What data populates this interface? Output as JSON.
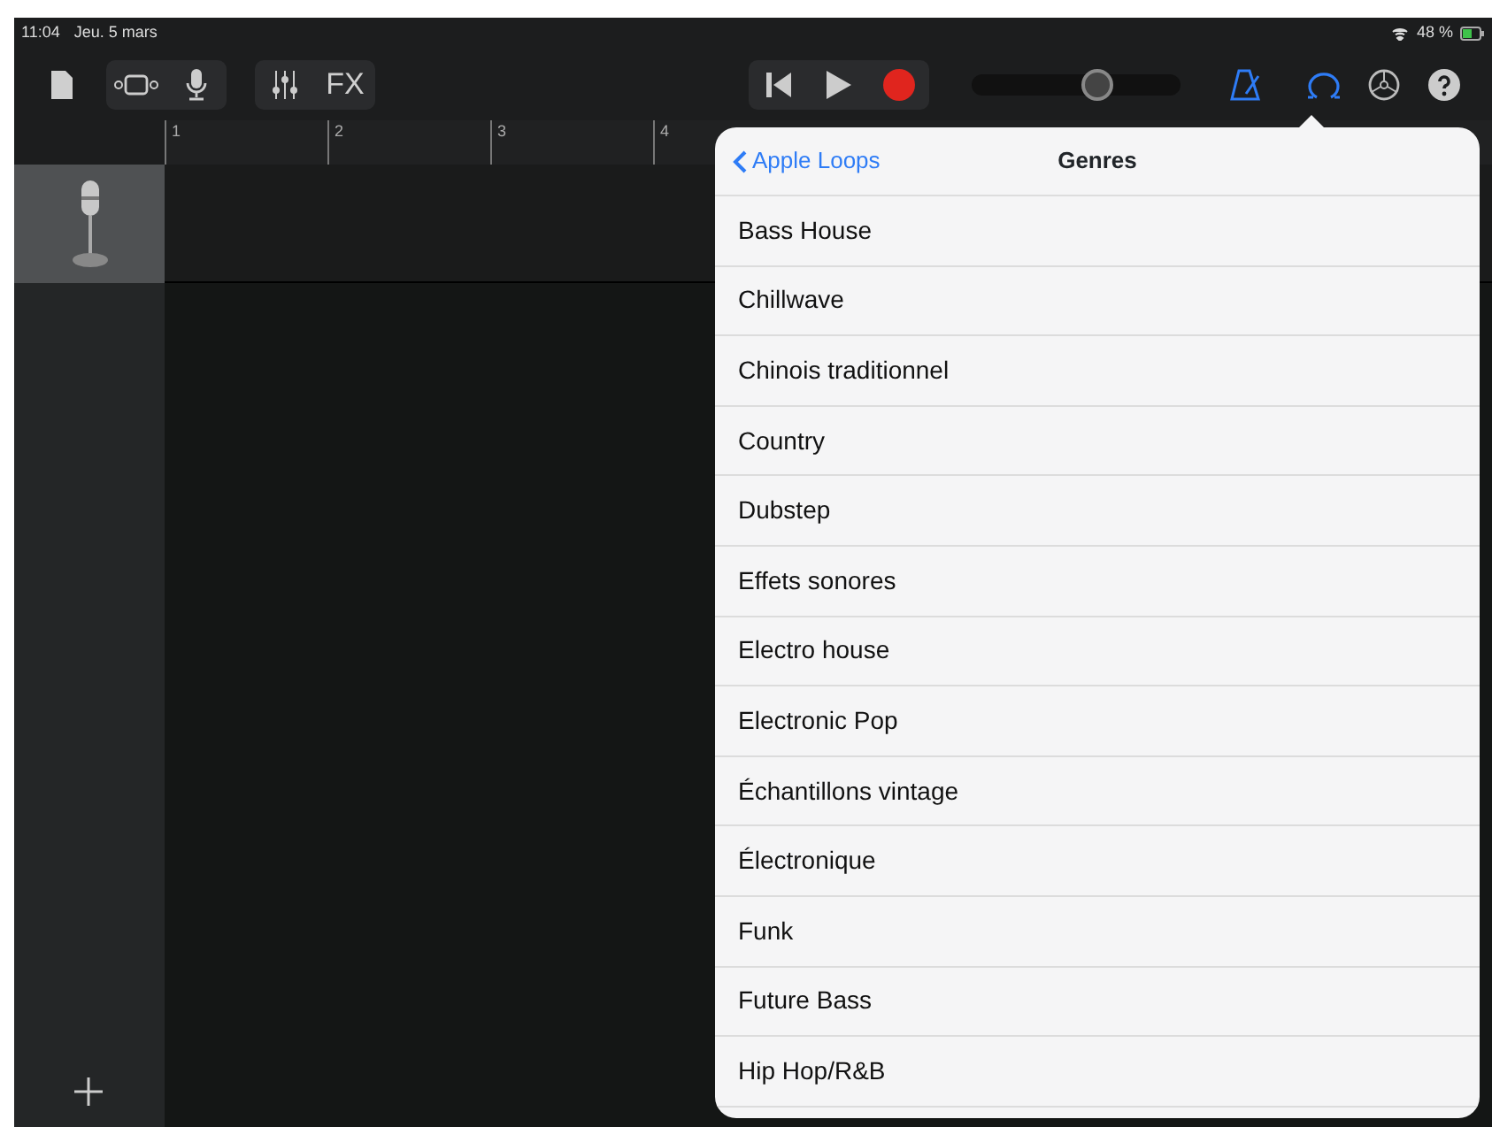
{
  "status_bar": {
    "time": "11:04",
    "date": "Jeu. 5 mars",
    "battery": "48 %"
  },
  "toolbar": {
    "fx_label": "FX",
    "volume": {
      "level": 0.6
    },
    "metronome_on": true,
    "loops_on": true
  },
  "ruler": {
    "bars": [
      "1",
      "2",
      "3",
      "4"
    ]
  },
  "popover": {
    "back": "Apple Loops",
    "title": "Genres",
    "items": [
      {
        "label": "Bass House"
      },
      {
        "label": "Chillwave"
      },
      {
        "label": "Chinois traditionnel"
      },
      {
        "label": "Country"
      },
      {
        "label": "Dubstep"
      },
      {
        "label": "Effets sonores"
      },
      {
        "label": "Electro house"
      },
      {
        "label": "Electronic Pop"
      },
      {
        "label": "Échantillons vintage"
      },
      {
        "label": "Électronique"
      },
      {
        "label": "Funk"
      },
      {
        "label": "Future Bass"
      },
      {
        "label": "Hip Hop/R&B"
      }
    ]
  }
}
